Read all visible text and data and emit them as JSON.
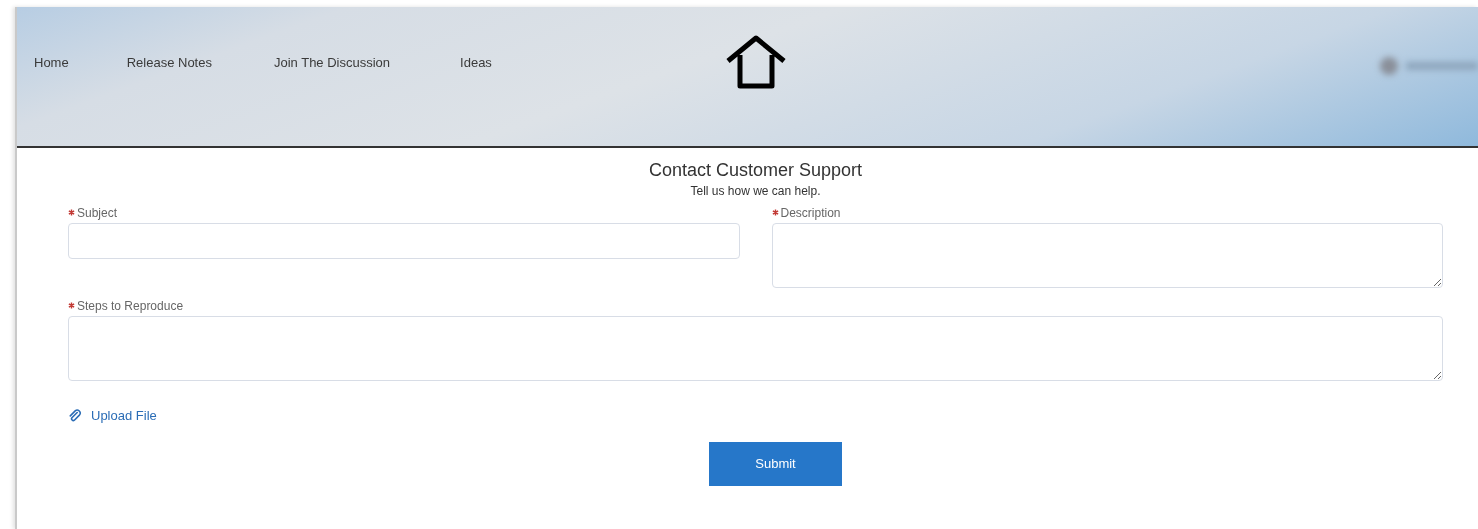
{
  "nav": {
    "items": [
      {
        "label": "Home"
      },
      {
        "label": "Release Notes"
      },
      {
        "label": "Join The Discussion"
      },
      {
        "label": "Ideas"
      }
    ]
  },
  "form": {
    "title": "Contact Customer Support",
    "subtitle": "Tell us how we can help.",
    "rows": [
      [
        {
          "label": "Subject",
          "required": true,
          "kind": "input"
        },
        {
          "label": "Description",
          "required": true,
          "kind": "textarea"
        }
      ],
      [
        {
          "label": "Steps to Reproduce",
          "required": true,
          "kind": "textarea"
        }
      ]
    ],
    "upload": {
      "label": "Upload File"
    },
    "submit": {
      "label": "Submit"
    }
  }
}
